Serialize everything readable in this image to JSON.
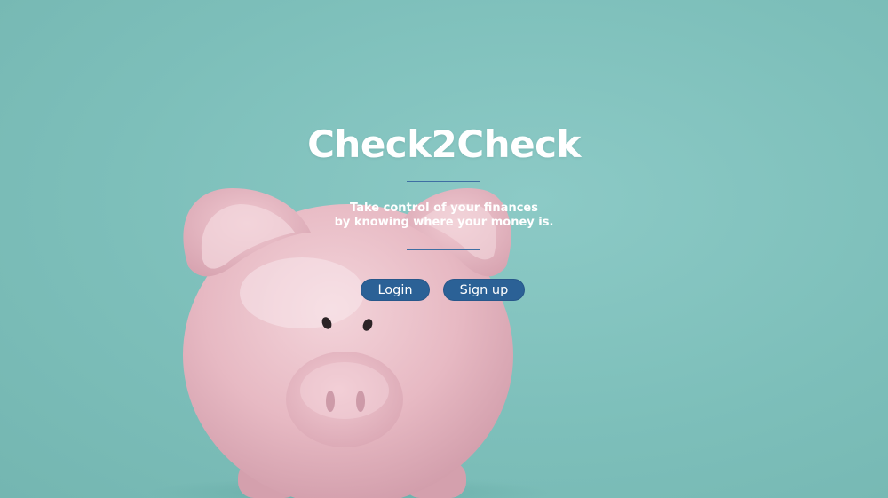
{
  "hero": {
    "title": "Check2Check",
    "tagline": {
      "line1": "Take control of your finances",
      "line2": "by knowing where your money is."
    },
    "background_image": "piggy-bank-photo"
  },
  "actions": {
    "login_label": "Login",
    "signup_label": "Sign up"
  },
  "colors": {
    "background": "#7fc1bc",
    "button": "#2b6196",
    "divider": "#3f6fa3",
    "text": "#ffffff",
    "piggy": "#e8bcc6"
  }
}
